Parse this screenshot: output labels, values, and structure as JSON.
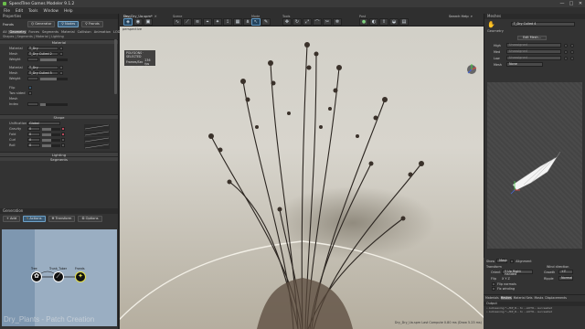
{
  "window": {
    "title": "SpeedTree Games Modeler 9.1.2",
    "min": "—",
    "max": "□",
    "close": "✕"
  },
  "menu": [
    "File",
    "Edit",
    "Tools",
    "Window",
    "Help"
  ],
  "tabs": {
    "file": "Dry_Dry_Ua.spm*",
    "close": "✕"
  },
  "search": {
    "label": "Search Help"
  },
  "toolbar": {
    "groups": [
      {
        "label": "View"
      },
      {
        "label": "Scene"
      },
      {
        "label": "Mode"
      },
      {
        "label": "Tools"
      },
      {
        "label": "Post"
      }
    ]
  },
  "properties": {
    "title": "Properties",
    "path": "Fronds",
    "buttons": {
      "generator": "Generator",
      "nodes": "Nodes",
      "fronds": "Fronds"
    },
    "tabs": [
      "All",
      "Geometry",
      "Forces",
      "Segments",
      "Material",
      "Collision",
      "Animation",
      "LOD"
    ],
    "subpath": "Shapes | Segments | Material | Lighting",
    "material_header": "Material",
    "materials": [
      {
        "material_label": "Material",
        "material_value": "T_Dry",
        "mesh_label": "Mesh",
        "mesh_value": "T_Dry Culled 2",
        "weight_label": "Weight"
      },
      {
        "material_label": "Material",
        "material_value": "T_Dry",
        "mesh_label": "Mesh",
        "mesh_value": "T_Dry Culled 5",
        "weight_label": "Weight"
      }
    ],
    "flip_label": "Flip",
    "two_sided_label": "Two sided",
    "mesh_label": "Mesh",
    "index_label": "Index",
    "shape_header": "Shape",
    "shape_rows": [
      {
        "label": "Unification",
        "value": "Global"
      },
      {
        "label": "Gravity",
        "value": "0"
      },
      {
        "label": "Fold",
        "value": "0"
      },
      {
        "label": "Curl",
        "value": "0"
      },
      {
        "label": "Roll",
        "value": "0"
      }
    ],
    "lighting_header": "Lighting",
    "segments_header": "Segments"
  },
  "generator": {
    "title": "Generation",
    "buttons": [
      {
        "label": "Add",
        "icon": "plus-icon"
      },
      {
        "label": "Actions",
        "icon": "lightning-icon"
      },
      {
        "label": "Transform",
        "icon": "move-icon"
      },
      {
        "label": "Options",
        "icon": "gear-icon"
      }
    ],
    "nodes": [
      {
        "label": "Tree"
      },
      {
        "label": "Trunk_Tuber"
      },
      {
        "label": "Fronds"
      }
    ],
    "watermark": "Dry_Plants - Patch Creation"
  },
  "viewport": {
    "label": "perspective",
    "stats": {
      "line1": "POLYGONS · SELECTED",
      "line2_label": "Frames/Sec",
      "line2_value": "236 fps",
      "line3_label": "TOTAL",
      "line3_value": "158"
    },
    "status": "Dry_Dry_Ua.spm  Last Compute 0.80 ms (Draw 5.23 ms)"
  },
  "meshes": {
    "title": "Meshes",
    "selected": "T_Dry Culled 4",
    "geometry_header": "Geometry",
    "edit_button": "Edit Mesh...",
    "lods": [
      {
        "label": "High",
        "value": "Unassigned"
      },
      {
        "label": "Med",
        "value": "Unassigned"
      },
      {
        "label": "Low",
        "value": "Unassigned"
      },
      {
        "label": "Mesh",
        "value": "None"
      }
    ],
    "show_label": "Show",
    "show_value": "Mesh",
    "alignment_label": "Alignment",
    "transform_header": "Transform",
    "orient_label": "Orient",
    "orient_value": "Y Up Right Handed",
    "flip_label": "Flip",
    "flip_value": "X  Y  Z",
    "fill_normals": "Flip normals",
    "fix_winding": "Fix winding",
    "wind_header": "Wind direction",
    "growth_label": "Growth",
    "growth_value": "+Y",
    "ripple_label": "Ripple",
    "ripple_value": "Normal",
    "bottom_tabs": [
      "Materials",
      "Meshes",
      "Material Sets",
      "Masks",
      "Displacements"
    ]
  },
  "output": {
    "title": "Output",
    "lines": [
      "• Autosaving *~/RP_D... to ...AUTO... succeeded",
      "• Autosaving *~/RP_D... to ...AUTO... succeeded"
    ]
  },
  "colors": {
    "accent": "#6ea2c8",
    "node_tree": "#e8e8e8",
    "node_trunk": "#e8e8e8",
    "node_fronds": "#e6e14a",
    "generator_bg": "#9aaec2"
  }
}
